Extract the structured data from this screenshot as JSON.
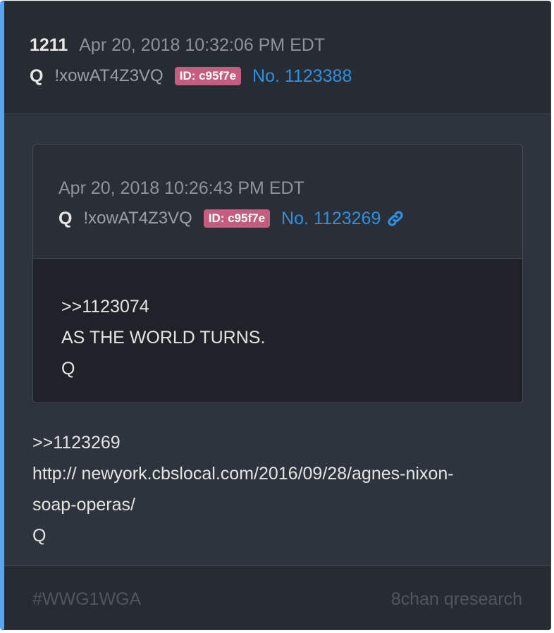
{
  "post": {
    "number": "1211",
    "timestamp": "Apr 20, 2018 10:32:06 PM EDT",
    "name": "Q",
    "tripcode": "!xowAT4Z3VQ",
    "id_badge": "ID: c95f7e",
    "post_link": "No. 1123388"
  },
  "quoted": {
    "timestamp": "Apr 20, 2018 10:26:43 PM EDT",
    "name": "Q",
    "tripcode": "!xowAT4Z3VQ",
    "id_badge": "ID: c95f7e",
    "post_link": "No. 1123269",
    "link_icon": "link-icon",
    "lines": [
      ">>1123074",
      "AS THE WORLD TURNS.",
      "Q"
    ]
  },
  "body": {
    "lines": [
      ">>1123269",
      "http:// newyork.cbslocal.com/2016/09/28/agnes-nixon-",
      "soap-operas/",
      "Q"
    ]
  },
  "footer": {
    "hashtag": "#WWG1WGA",
    "source": "8chan qresearch"
  },
  "colors": {
    "accent_bar": "#5aa3f5",
    "id_badge": "#c45d80",
    "link": "#2f8fe0",
    "card_bg": "#2e343d",
    "quote_body_bg": "#1f2228"
  }
}
